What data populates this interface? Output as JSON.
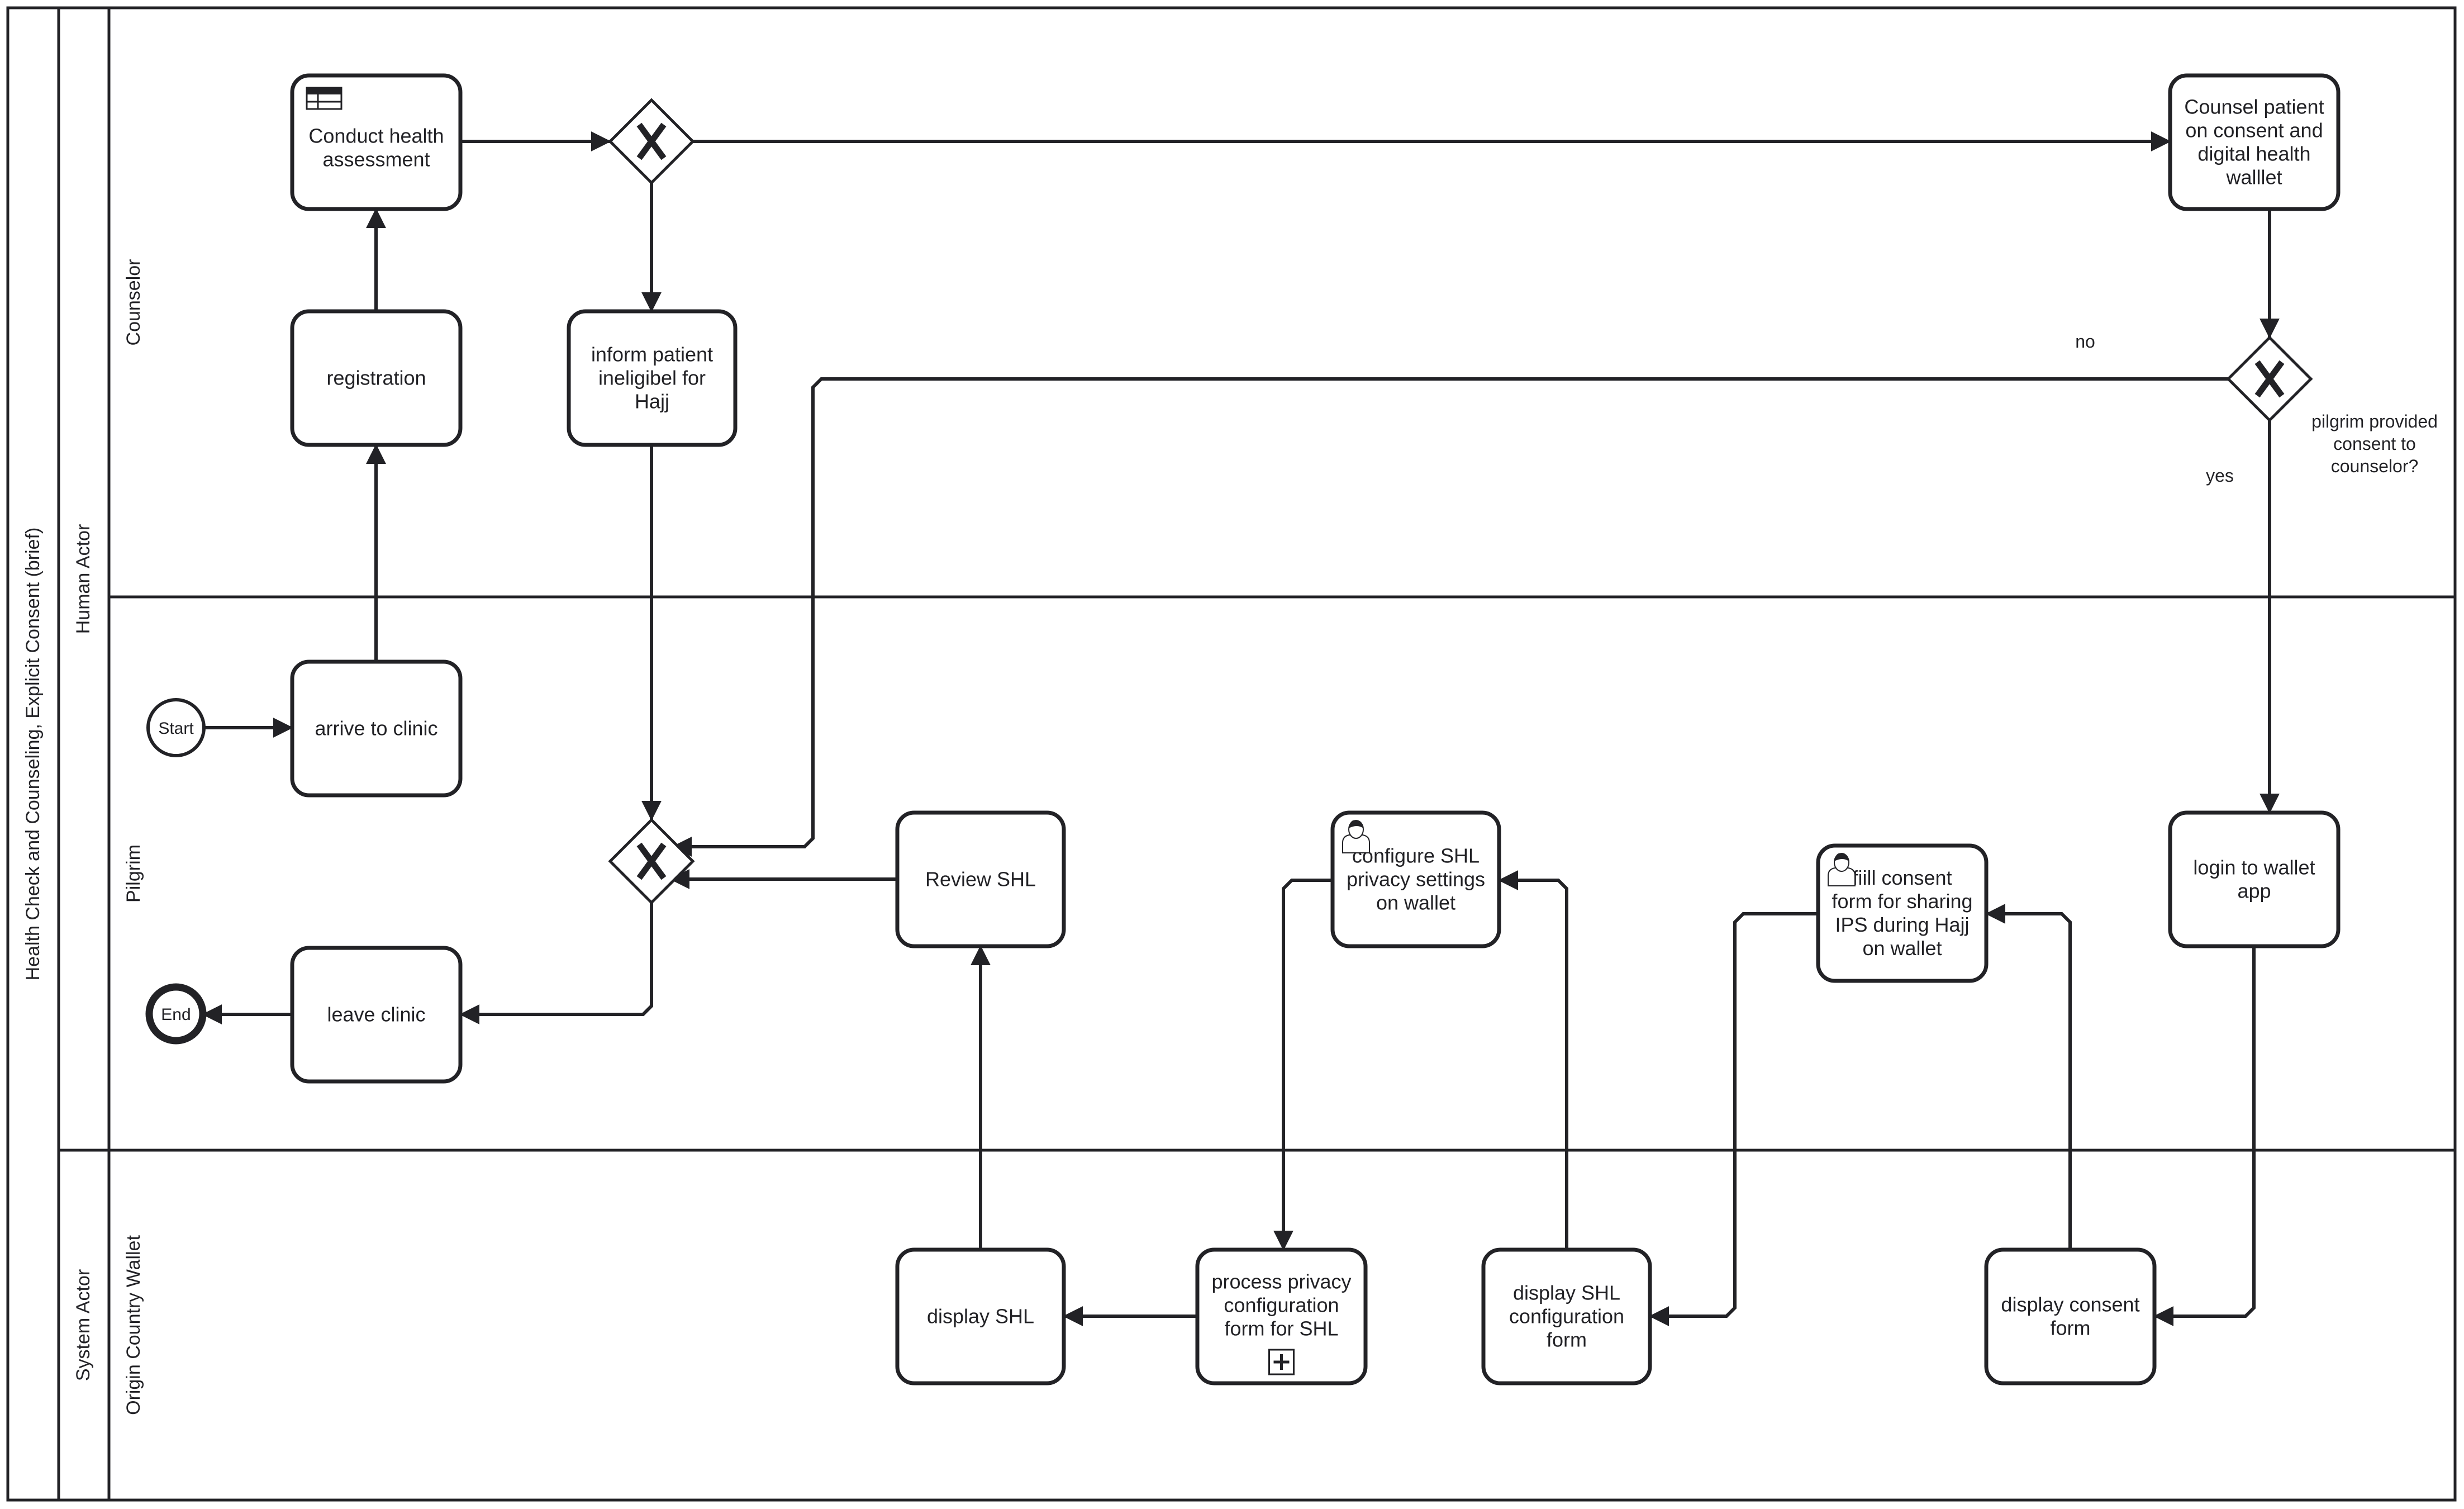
{
  "pool": {
    "title": "Health Check and Counseling, Explicit Consent (brief)"
  },
  "lane_groups": [
    {
      "id": "human",
      "label": "Human Actor"
    },
    {
      "id": "system",
      "label": "System Actor"
    }
  ],
  "lanes": [
    {
      "id": "counselor",
      "label": "Counselor",
      "group": "human"
    },
    {
      "id": "pilgrim",
      "label": "Pilgrim",
      "group": "human"
    },
    {
      "id": "wallet",
      "label": "Origin Country Wallet",
      "group": "system"
    }
  ],
  "events": [
    {
      "id": "start",
      "type": "start",
      "label": "Start",
      "lane": "pilgrim"
    },
    {
      "id": "end",
      "type": "end",
      "label": "End",
      "lane": "pilgrim"
    }
  ],
  "tasks": [
    {
      "id": "conduct",
      "lane": "counselor",
      "lines": [
        "Conduct health",
        "assessment"
      ],
      "marker": "business-rule"
    },
    {
      "id": "registration",
      "lane": "counselor",
      "lines": [
        "registration"
      ],
      "marker": ""
    },
    {
      "id": "inform",
      "lane": "counselor",
      "lines": [
        "inform patient",
        "ineligibel for",
        "Hajj"
      ],
      "marker": ""
    },
    {
      "id": "counsel",
      "lane": "counselor",
      "lines": [
        "Counsel patient",
        "on consent and",
        "digital health",
        "walllet"
      ],
      "marker": ""
    },
    {
      "id": "arrive",
      "lane": "pilgrim",
      "lines": [
        "arrive to clinic"
      ],
      "marker": ""
    },
    {
      "id": "leave",
      "lane": "pilgrim",
      "lines": [
        "leave clinic"
      ],
      "marker": ""
    },
    {
      "id": "review",
      "lane": "pilgrim",
      "lines": [
        "Review SHL"
      ],
      "marker": ""
    },
    {
      "id": "configure",
      "lane": "pilgrim",
      "lines": [
        "configure SHL",
        "privacy settings",
        "on wallet"
      ],
      "marker": "user"
    },
    {
      "id": "fill",
      "lane": "pilgrim",
      "lines": [
        "fiill consent",
        "form for sharing",
        "IPS during Hajj",
        "on wallet"
      ],
      "marker": "user"
    },
    {
      "id": "login",
      "lane": "pilgrim",
      "lines": [
        "login to wallet",
        "app"
      ],
      "marker": ""
    },
    {
      "id": "displayshl",
      "lane": "wallet",
      "lines": [
        "display SHL"
      ],
      "marker": ""
    },
    {
      "id": "process",
      "lane": "wallet",
      "lines": [
        "process privacy",
        "configuration",
        "form for SHL"
      ],
      "marker": "subprocess"
    },
    {
      "id": "displayconfig",
      "lane": "wallet",
      "lines": [
        "display SHL",
        "configuration",
        "form"
      ],
      "marker": ""
    },
    {
      "id": "displayconsent",
      "lane": "wallet",
      "lines": [
        "display consent",
        "form"
      ],
      "marker": ""
    }
  ],
  "gateways": [
    {
      "id": "gw_eligible",
      "type": "exclusive",
      "lane": "counselor",
      "label": ""
    },
    {
      "id": "gw_consent",
      "type": "exclusive",
      "lane": "counselor",
      "label": "pilgrim provided consent to counselor?"
    },
    {
      "id": "gw_merge",
      "type": "exclusive",
      "lane": "pilgrim",
      "label": ""
    }
  ],
  "gateway_label_lines": [
    "pilgrim provided",
    "consent to",
    "counselor?"
  ],
  "flows": [
    {
      "from": "start",
      "to": "arrive",
      "label": ""
    },
    {
      "from": "arrive",
      "to": "registration",
      "label": ""
    },
    {
      "from": "registration",
      "to": "conduct",
      "label": ""
    },
    {
      "from": "conduct",
      "to": "gw_eligible",
      "label": ""
    },
    {
      "from": "gw_eligible",
      "to": "counsel",
      "label": ""
    },
    {
      "from": "gw_eligible",
      "to": "inform",
      "label": ""
    },
    {
      "from": "inform",
      "to": "gw_merge",
      "label": ""
    },
    {
      "from": "counsel",
      "to": "gw_consent",
      "label": ""
    },
    {
      "from": "gw_consent",
      "to": "gw_merge",
      "label": "no"
    },
    {
      "from": "gw_consent",
      "to": "login",
      "label": "yes"
    },
    {
      "from": "login",
      "to": "displayconsent",
      "label": ""
    },
    {
      "from": "displayconsent",
      "to": "fill",
      "label": ""
    },
    {
      "from": "fill",
      "to": "displayconfig",
      "label": ""
    },
    {
      "from": "displayconfig",
      "to": "configure",
      "label": ""
    },
    {
      "from": "configure",
      "to": "process",
      "label": ""
    },
    {
      "from": "process",
      "to": "displayshl",
      "label": ""
    },
    {
      "from": "displayshl",
      "to": "review",
      "label": ""
    },
    {
      "from": "review",
      "to": "gw_merge",
      "label": ""
    },
    {
      "from": "gw_merge",
      "to": "leave",
      "label": ""
    },
    {
      "from": "leave",
      "to": "end",
      "label": ""
    }
  ],
  "flow_labels": {
    "no": "no",
    "yes": "yes"
  }
}
